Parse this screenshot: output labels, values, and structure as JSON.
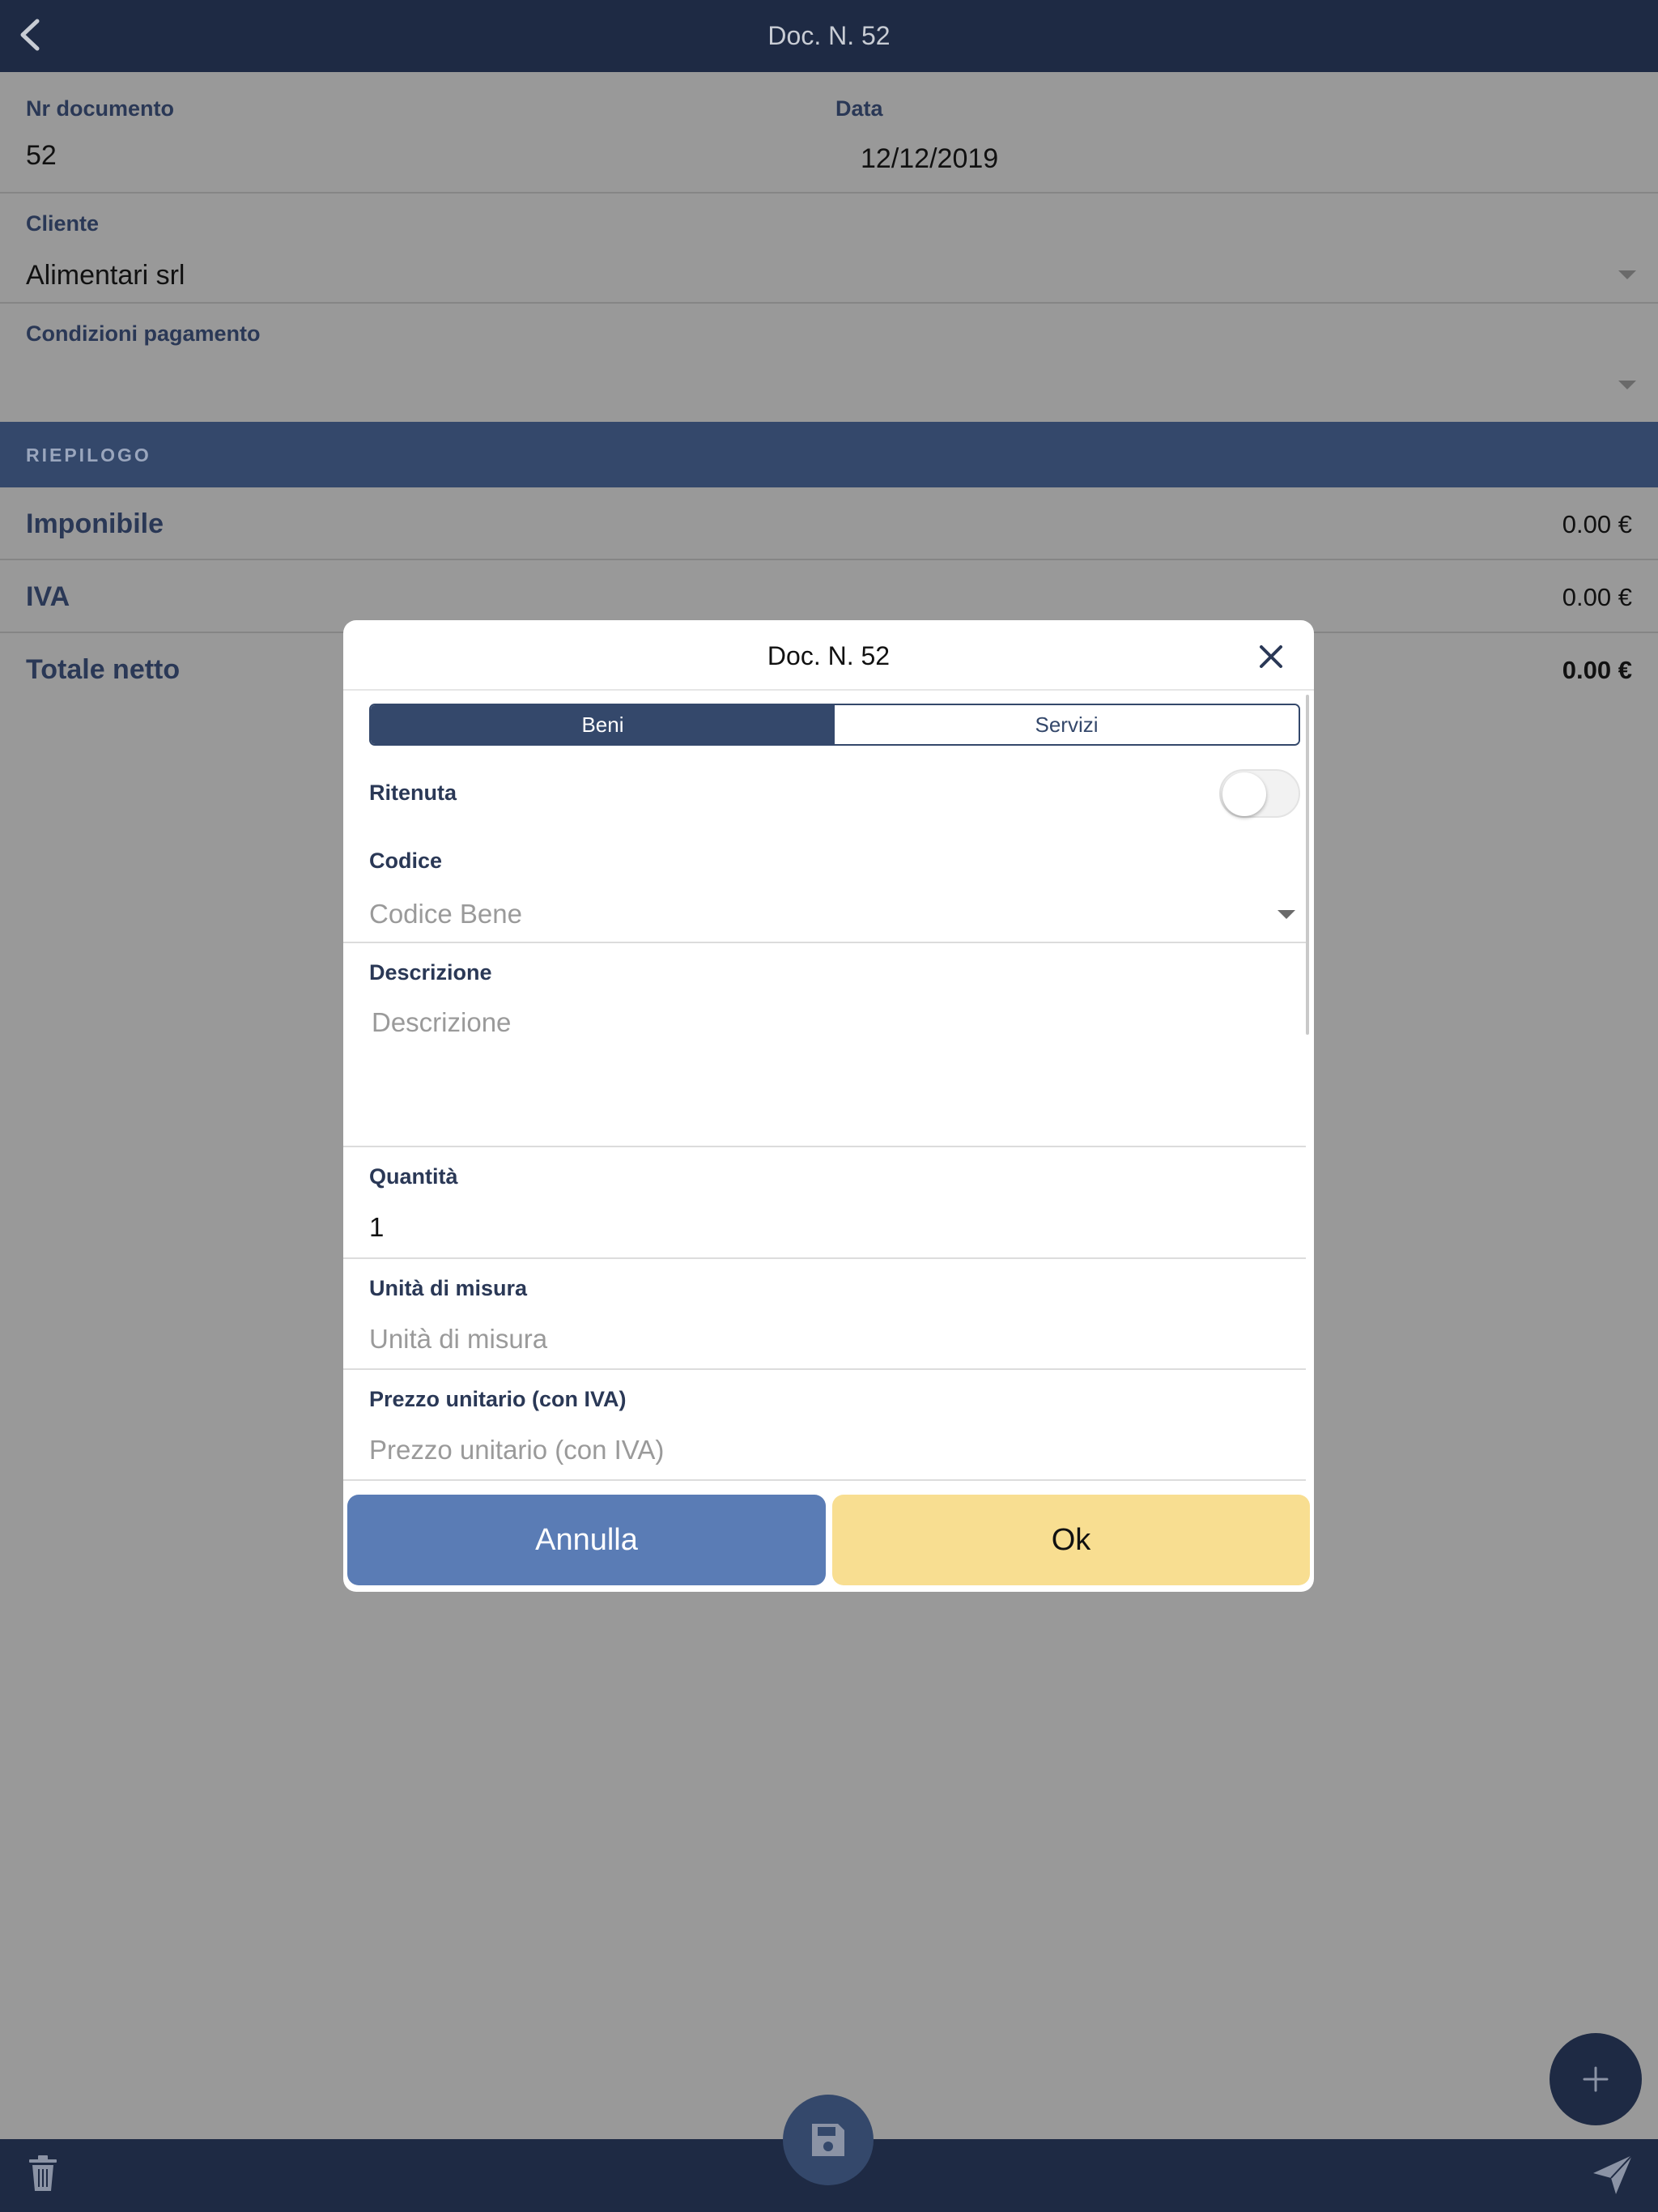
{
  "header": {
    "title": "Doc. N. 52",
    "back_icon": "chevron-left-icon"
  },
  "form": {
    "nr_documento": {
      "label": "Nr documento",
      "value": "52"
    },
    "data": {
      "label": "Data",
      "value": "12/12/2019"
    },
    "cliente": {
      "label": "Cliente",
      "value": "Alimentari srl"
    },
    "condizioni": {
      "label": "Condizioni pagamento",
      "value": ""
    }
  },
  "summary": {
    "section_title": "RIEPILOGO",
    "rows": [
      {
        "label": "Imponibile",
        "value": "0.00 €"
      },
      {
        "label": "IVA",
        "value": "0.00 €"
      },
      {
        "label": "Totale netto",
        "value": "0.00 €"
      }
    ]
  },
  "modal": {
    "title": "Doc. N. 52",
    "close_icon": "close-icon",
    "segments": [
      "Beni",
      "Servizi"
    ],
    "selected_segment": "Beni",
    "ritenuta": {
      "label": "Ritenuta",
      "checked": false
    },
    "codice": {
      "label": "Codice",
      "placeholder": "Codice Bene"
    },
    "descrizione": {
      "label": "Descrizione",
      "placeholder": "Descrizione"
    },
    "quantita": {
      "label": "Quantità",
      "value": "1"
    },
    "unita": {
      "label": "Unità di misura",
      "placeholder": "Unità di misura"
    },
    "prezzo": {
      "label": "Prezzo unitario (con IVA)",
      "placeholder": "Prezzo unitario (con IVA)"
    },
    "cancel_label": "Annulla",
    "ok_label": "Ok"
  },
  "toolbar": {
    "trash_icon": "trash-icon",
    "save_icon": "floppy-disk-icon",
    "add_icon": "plus-icon",
    "send_icon": "paper-plane-icon"
  },
  "colors": {
    "header": "#1e2a44",
    "section": "#34486b",
    "cancel_button": "#5a7cb5",
    "ok_button": "#f8de91",
    "overlay": "#999999"
  }
}
